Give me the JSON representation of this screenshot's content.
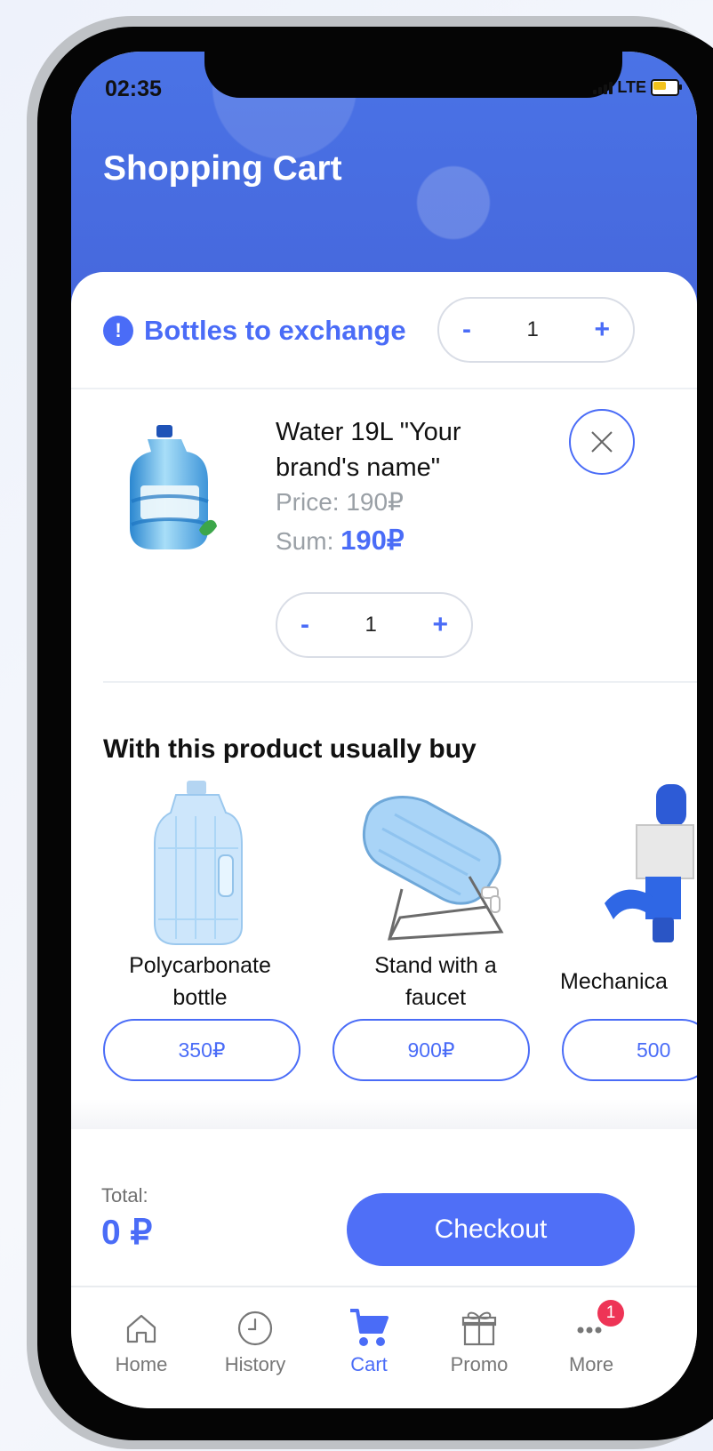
{
  "status": {
    "time": "02:35",
    "network": "LTE"
  },
  "header": {
    "title": "Shopping Cart"
  },
  "bottles_exchange": {
    "label": "Bottles to exchange",
    "icon": "info-icon",
    "quantity": "1",
    "minus": "-",
    "plus": "+"
  },
  "cart_item": {
    "name": "Water 19L \"Your brand's name\"",
    "price_label": "Price: 190₽",
    "sum_label": "Sum:",
    "sum_value": "190₽",
    "quantity": "1",
    "minus": "-",
    "plus": "+"
  },
  "recommendations": {
    "title": "With this product usually buy",
    "items": [
      {
        "name": "Polycarbonate bottle",
        "price": "350₽"
      },
      {
        "name": "Stand with a faucet",
        "price": "900₽"
      },
      {
        "name": "Mechanica",
        "price": "500"
      }
    ]
  },
  "totals": {
    "label": "Total:",
    "value": "0 ₽"
  },
  "checkout": {
    "label": "Checkout"
  },
  "tabs": [
    {
      "label": "Home",
      "icon": "home-icon"
    },
    {
      "label": "History",
      "icon": "clock-icon"
    },
    {
      "label": "Cart",
      "icon": "cart-icon",
      "active": true
    },
    {
      "label": "Promo",
      "icon": "gift-icon"
    },
    {
      "label": "More",
      "icon": "more-icon",
      "badge": "1"
    }
  ],
  "colors": {
    "accent": "#4A6CF7",
    "header_blue": "#4667DC",
    "badge_red": "#EE3456"
  }
}
